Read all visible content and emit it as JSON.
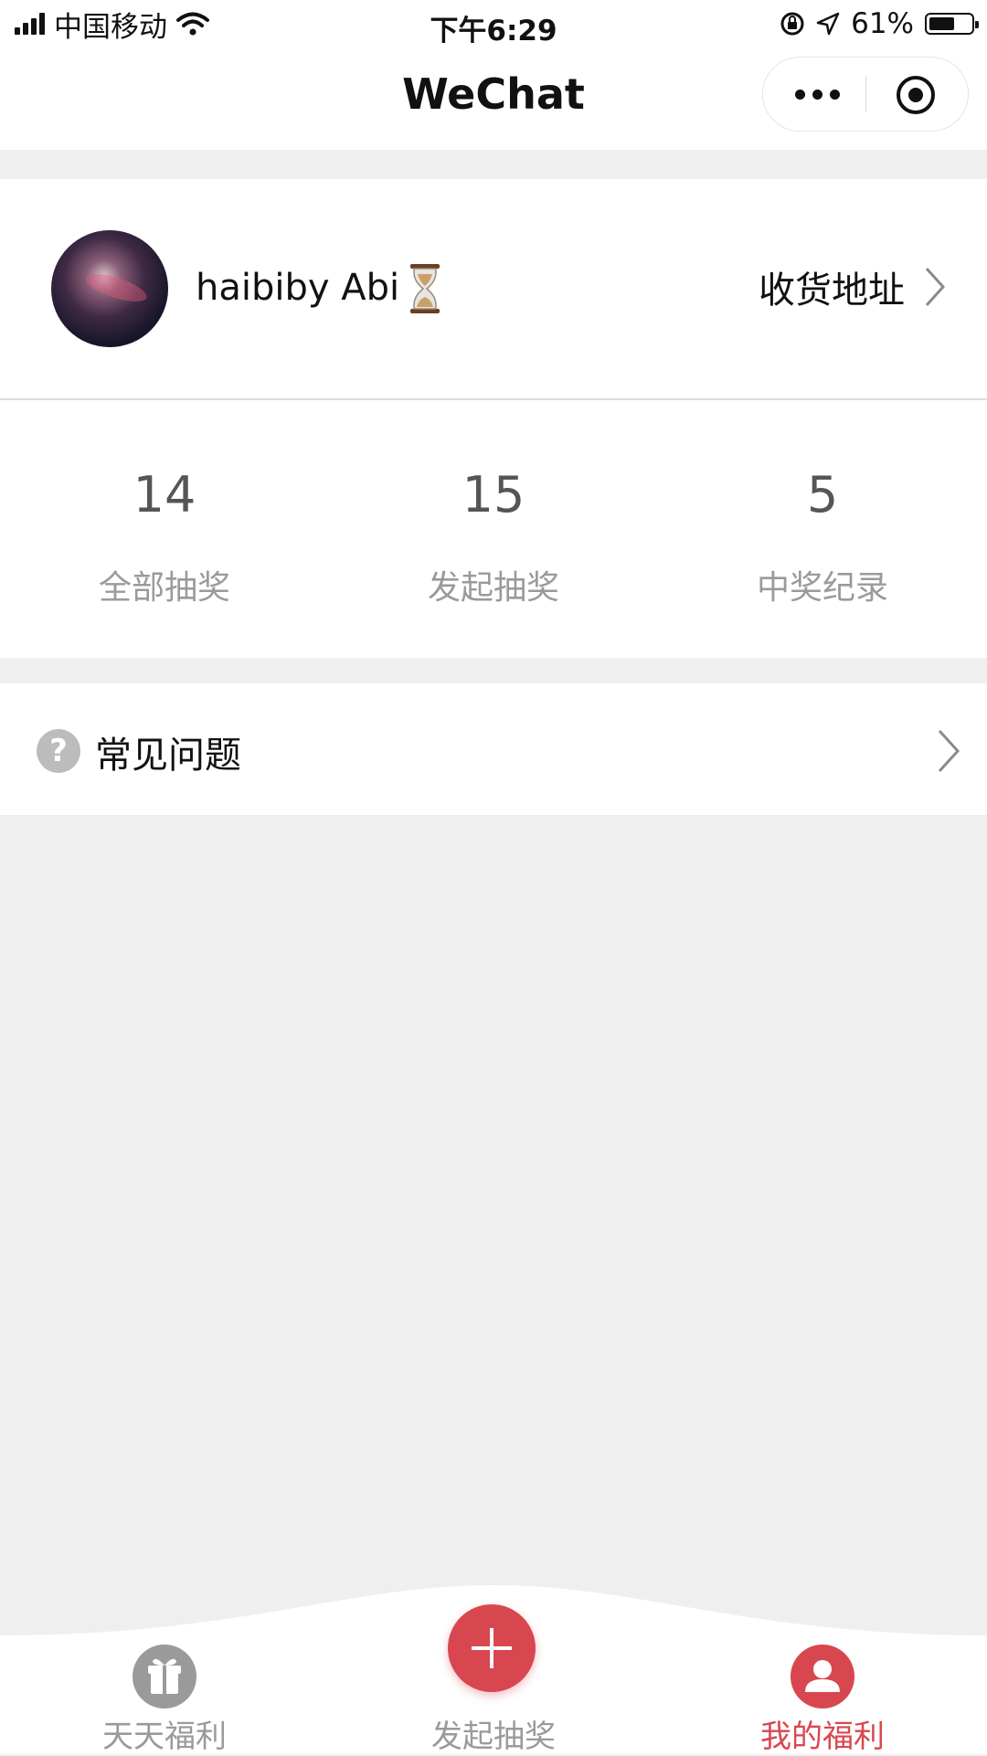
{
  "status_bar": {
    "carrier": "中国移动",
    "time": "下午6:29",
    "battery_percent": "61%",
    "battery_level": 0.61,
    "icons": [
      "signal-icon",
      "wifi-icon",
      "orientation-lock-icon",
      "location-icon",
      "battery-icon"
    ]
  },
  "nav": {
    "title": "WeChat",
    "icons": [
      "more-icon",
      "close-miniprogram-icon"
    ]
  },
  "profile": {
    "username": "haibiby Abi",
    "emoji": "⏳",
    "address_label": "收货地址"
  },
  "stats": [
    {
      "value": "14",
      "label": "全部抽奖"
    },
    {
      "value": "15",
      "label": "发起抽奖"
    },
    {
      "value": "5",
      "label": "中奖纪录"
    }
  ],
  "faq": {
    "label": "常见问题",
    "icon": "question-icon"
  },
  "tabs": [
    {
      "label": "天天福利",
      "icon": "gift-icon",
      "active": false
    },
    {
      "label": "发起抽奖",
      "icon": "plus-icon",
      "active": false
    },
    {
      "label": "我的福利",
      "icon": "user-icon",
      "active": true
    }
  ],
  "colors": {
    "accent": "#d8474f",
    "inactive": "#9a9a9a",
    "background": "#efefef"
  }
}
